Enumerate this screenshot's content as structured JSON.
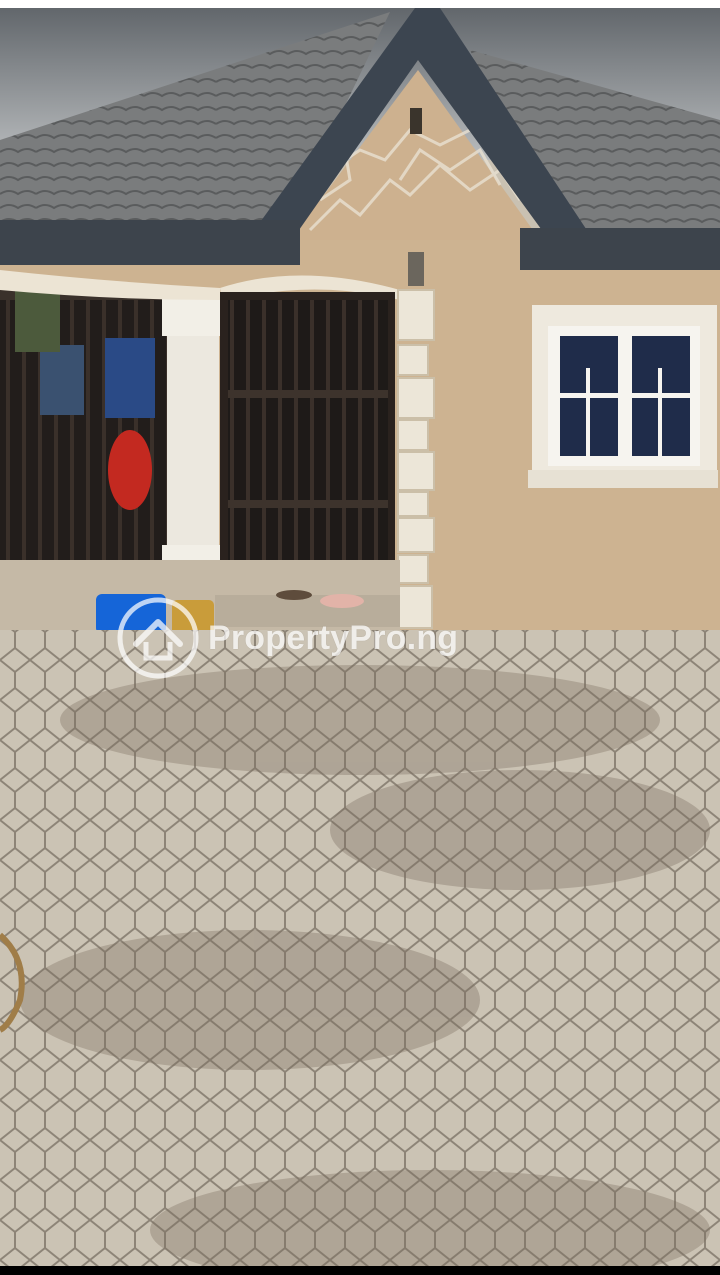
{
  "scene": {
    "description_type": "photo",
    "colors": {
      "sky": "#8f9498",
      "roof": "#77797a",
      "wall": "#cdb391",
      "floor": "#c9c1b2",
      "column": "#ede9e0",
      "gate": "#2b2420"
    }
  },
  "watermark": {
    "text": "PropertyPro.ng",
    "icon": "house-logo-icon"
  }
}
